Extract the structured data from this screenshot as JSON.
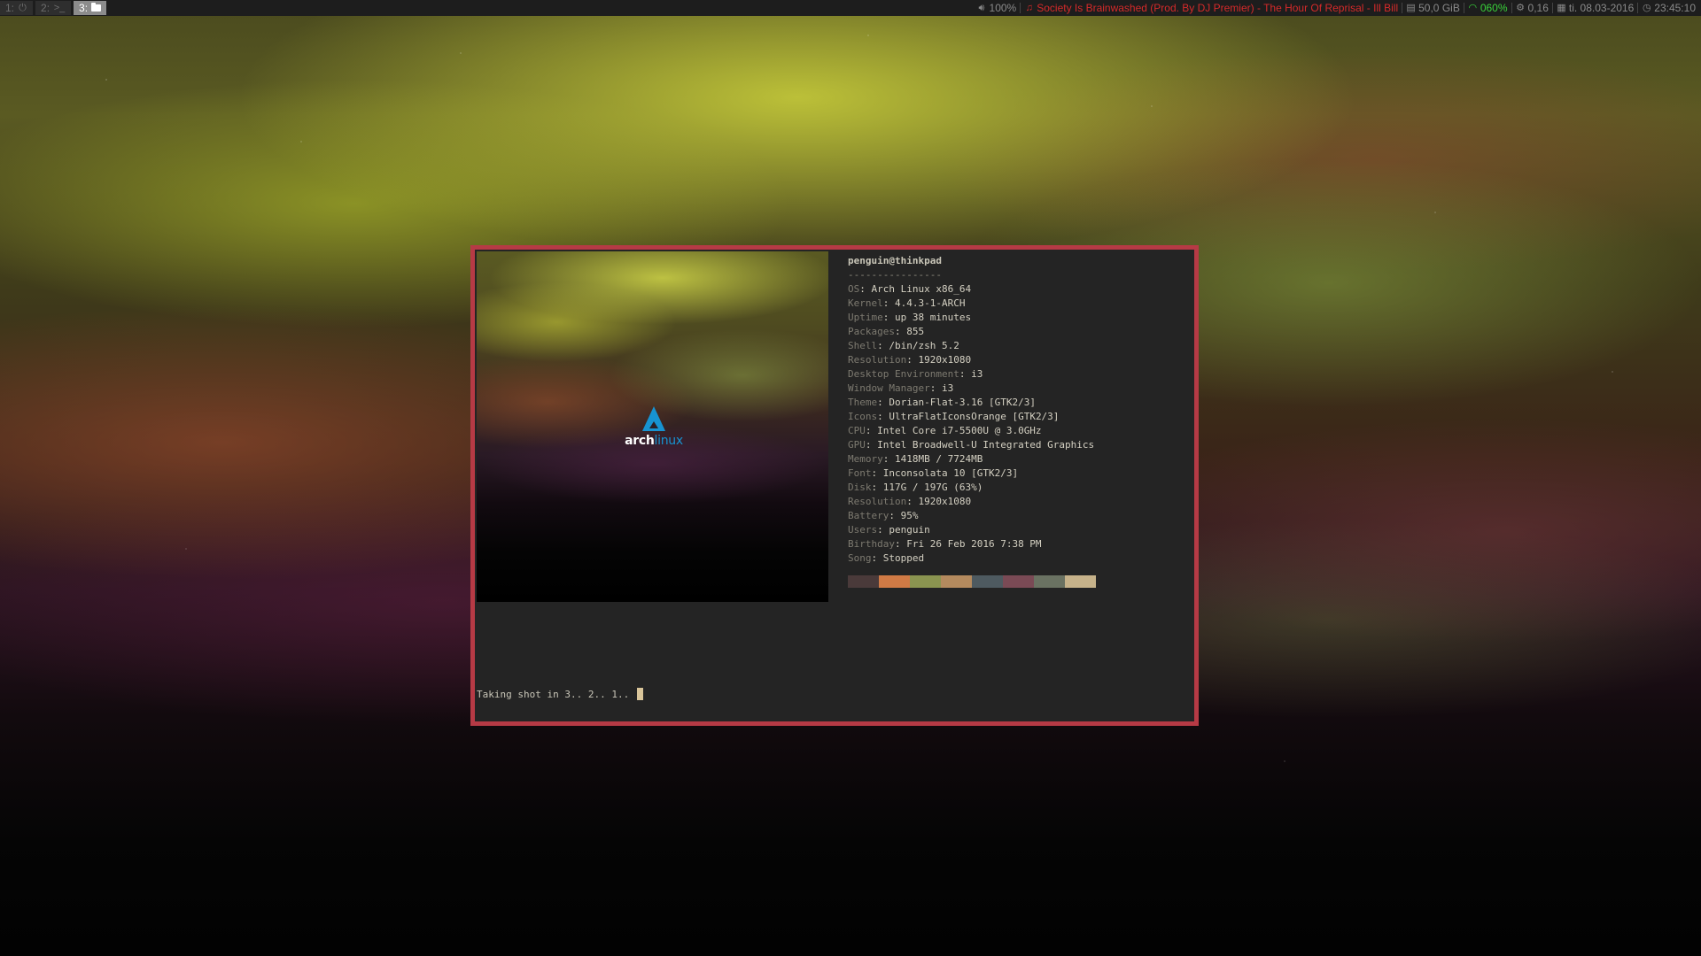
{
  "topbar": {
    "workspaces": [
      {
        "num": "1:",
        "icon": "power-icon",
        "glyph": "⏻",
        "active": false
      },
      {
        "num": "2:",
        "icon": "terminal-icon",
        "glyph": ">_",
        "active": false
      },
      {
        "num": "3:",
        "icon": "folder-icon",
        "glyph": "",
        "active": true
      }
    ],
    "volume": {
      "icon": "speaker-icon",
      "value": "100%"
    },
    "song": {
      "icon": "music-note-icon",
      "value": "Society Is Brainwashed (Prod. By DJ Premier) - The Hour Of Reprisal - Ill Bill",
      "color": "#d42a2a"
    },
    "disk": {
      "icon": "disk-icon",
      "value": "50,0 GiB"
    },
    "wifi": {
      "icon": "wifi-icon",
      "value": "060%",
      "color": "#39d13a"
    },
    "load": {
      "icon": "cpu-icon",
      "value": "0,16"
    },
    "date": {
      "icon": "calendar-icon",
      "value": "ti. 08.03-2016"
    },
    "time": {
      "icon": "clock-icon",
      "value": "23:45:10"
    }
  },
  "terminal": {
    "border_color": "#b63a45",
    "logo": {
      "word1": "arch",
      "word2": "linux",
      "accent": "#1793d1"
    },
    "user_host": "penguin@thinkpad",
    "separator": "----------------",
    "info": [
      {
        "key": "OS",
        "value": "Arch Linux x86_64"
      },
      {
        "key": "Kernel",
        "value": "4.4.3-1-ARCH"
      },
      {
        "key": "Uptime",
        "value": "up 38 minutes"
      },
      {
        "key": "Packages",
        "value": "855"
      },
      {
        "key": "Shell",
        "value": "/bin/zsh 5.2"
      },
      {
        "key": "Resolution",
        "value": "1920x1080"
      },
      {
        "key": "Desktop Environment",
        "value": "i3"
      },
      {
        "key": "Window Manager",
        "value": "i3"
      },
      {
        "key": "Theme",
        "value": "Dorian-Flat-3.16 [GTK2/3]"
      },
      {
        "key": "Icons",
        "value": "UltraFlatIconsOrange [GTK2/3]"
      },
      {
        "key": "CPU",
        "value": "Intel Core i7-5500U @ 3.0GHz"
      },
      {
        "key": "GPU",
        "value": "Intel Broadwell-U Integrated Graphics"
      },
      {
        "key": "Memory",
        "value": "1418MB / 7724MB"
      },
      {
        "key": "Font",
        "value": "Inconsolata 10 [GTK2/3]"
      },
      {
        "key": "Disk",
        "value": "117G / 197G (63%)"
      },
      {
        "key": "Resolution",
        "value": "1920x1080"
      },
      {
        "key": "Battery",
        "value": "95%"
      },
      {
        "key": "Users",
        "value": "penguin"
      },
      {
        "key": "Birthday",
        "value": "Fri 26 Feb 2016 7:38 PM"
      },
      {
        "key": "Song",
        "value": "Stopped"
      }
    ],
    "palette": [
      "#4a3a3a",
      "#d07a45",
      "#8a9450",
      "#b48a5e",
      "#4e5a60",
      "#7a4a55",
      "#6a7262",
      "#c6b28a"
    ],
    "prompt": "Taking shot in 3.. 2.. 1.."
  }
}
